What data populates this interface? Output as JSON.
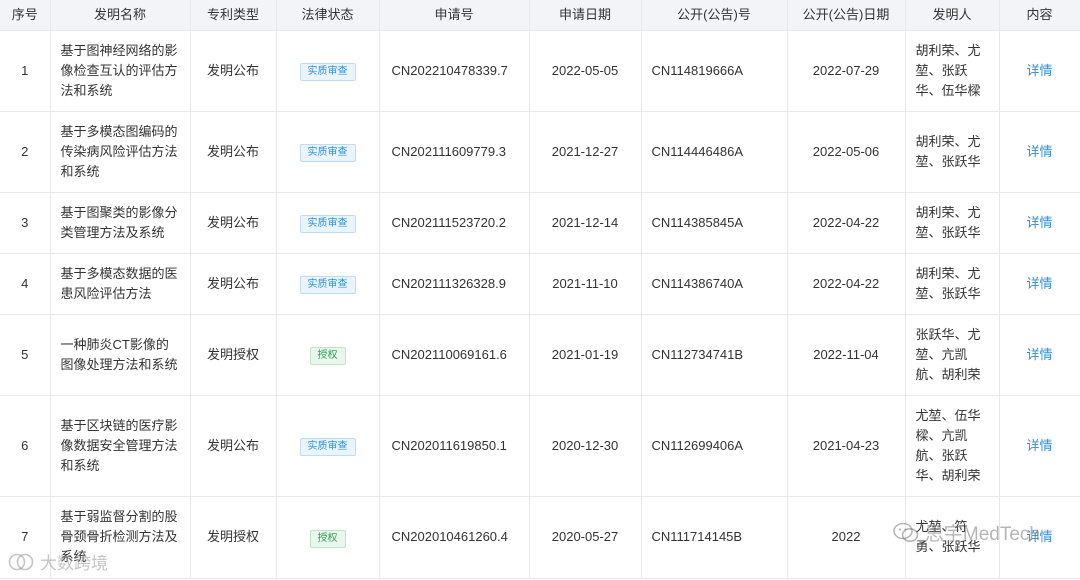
{
  "table": {
    "headers": [
      "序号",
      "发明名称",
      "专利类型",
      "法律状态",
      "申请号",
      "申请日期",
      "公开(公告)号",
      "公开(公告)日期",
      "发明人",
      "内容"
    ],
    "rows": [
      {
        "no": "1",
        "name": "基于图神经网络的影像检查互认的评估方法和系统",
        "type": "发明公布",
        "status": "实质审查",
        "app_no": "CN202210478339.7",
        "app_date": "2022-05-05",
        "pub_no": "CN114819666A",
        "pub_date": "2022-07-29",
        "inventors": "胡利荣、尤堃、张跃华、伍华樑",
        "detail": "详情"
      },
      {
        "no": "2",
        "name": "基于多模态图编码的传染病风险评估方法和系统",
        "type": "发明公布",
        "status": "实质审查",
        "app_no": "CN202111609779.3",
        "app_date": "2021-12-27",
        "pub_no": "CN114446486A",
        "pub_date": "2022-05-06",
        "inventors": "胡利荣、尤堃、张跃华",
        "detail": "详情"
      },
      {
        "no": "3",
        "name": "基于图聚类的影像分类管理方法及系统",
        "type": "发明公布",
        "status": "实质审查",
        "app_no": "CN202111523720.2",
        "app_date": "2021-12-14",
        "pub_no": "CN114385845A",
        "pub_date": "2022-04-22",
        "inventors": "胡利荣、尤堃、张跃华",
        "detail": "详情"
      },
      {
        "no": "4",
        "name": "基于多模态数据的医患风险评估方法",
        "type": "发明公布",
        "status": "实质审查",
        "app_no": "CN202111326328.9",
        "app_date": "2021-11-10",
        "pub_no": "CN114386740A",
        "pub_date": "2022-04-22",
        "inventors": "胡利荣、尤堃、张跃华",
        "detail": "详情"
      },
      {
        "no": "5",
        "name": "一种肺炎CT影像的图像处理方法和系统",
        "type": "发明授权",
        "status": "授权",
        "app_no": "CN202110069161.6",
        "app_date": "2021-01-19",
        "pub_no": "CN112734741B",
        "pub_date": "2022-11-04",
        "inventors": "张跃华、尤堃、亢凯航、胡利荣",
        "detail": "详情"
      },
      {
        "no": "6",
        "name": "基于区块链的医疗影像数据安全管理方法和系统",
        "type": "发明公布",
        "status": "实质审查",
        "app_no": "CN202011619850.1",
        "app_date": "2020-12-30",
        "pub_no": "CN112699406A",
        "pub_date": "2021-04-23",
        "inventors": "尤堃、伍华樑、亢凯航、张跃华、胡利荣",
        "detail": "详情"
      },
      {
        "no": "7",
        "name": "基于弱监督分割的股骨颈骨折检测方法及系统",
        "type": "发明授权",
        "status": "授权",
        "app_no": "CN202010461260.4",
        "app_date": "2020-05-27",
        "pub_no": "CN111714145B",
        "pub_date": "2022",
        "inventors": "尤堃、符勇、张跃华",
        "detail": "详情"
      }
    ]
  },
  "watermarks": {
    "right": "思宇MedTech",
    "left": "大数跨境"
  },
  "colors": {
    "header_bg": "#f2f4f7",
    "border": "#e6e8eb",
    "link": "#2d8fe4",
    "exam_badge": "#2d8fe4",
    "grant_badge": "#2f9e54"
  }
}
